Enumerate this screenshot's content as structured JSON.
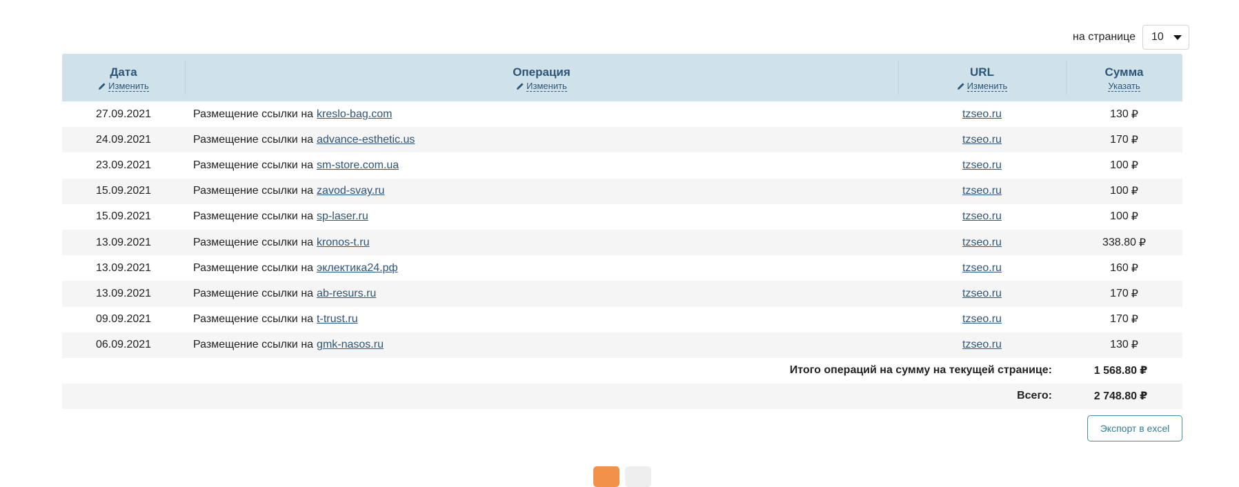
{
  "per_page": {
    "label": "на странице",
    "value": "10"
  },
  "columns": {
    "date": {
      "title": "Дата",
      "action": "Изменить"
    },
    "operation": {
      "title": "Операция",
      "action": "Изменить"
    },
    "url": {
      "title": "URL",
      "action": "Изменить"
    },
    "sum": {
      "title": "Сумма",
      "action": "Указать"
    }
  },
  "operation_prefix": "Размещение ссылки на",
  "currency": "₽",
  "rows": [
    {
      "date": "27.09.2021",
      "domain": "kreslo-bag.com",
      "url": "tzseo.ru",
      "sum": "130"
    },
    {
      "date": "24.09.2021",
      "domain": "advance-esthetic.us",
      "url": "tzseo.ru",
      "sum": "170"
    },
    {
      "date": "23.09.2021",
      "domain": "sm-store.com.ua",
      "url": "tzseo.ru",
      "sum": "100"
    },
    {
      "date": "15.09.2021",
      "domain": "zavod-svay.ru",
      "url": "tzseo.ru",
      "sum": "100"
    },
    {
      "date": "15.09.2021",
      "domain": "sp-laser.ru",
      "url": "tzseo.ru",
      "sum": "100"
    },
    {
      "date": "13.09.2021",
      "domain": "kronos-t.ru",
      "url": "tzseo.ru",
      "sum": "338.80"
    },
    {
      "date": "13.09.2021",
      "domain": "эклектика24.рф",
      "url": "tzseo.ru",
      "sum": "160"
    },
    {
      "date": "13.09.2021",
      "domain": "ab-resurs.ru",
      "url": "tzseo.ru",
      "sum": "170"
    },
    {
      "date": "09.09.2021",
      "domain": "t-trust.ru",
      "url": "tzseo.ru",
      "sum": "170"
    },
    {
      "date": "06.09.2021",
      "domain": "gmk-nasos.ru",
      "url": "tzseo.ru",
      "sum": "130"
    }
  ],
  "totals": {
    "page_label": "Итого операций на сумму на текущей странице:",
    "page_value": "1 568.80",
    "all_label": "Всего:",
    "all_value": "2 748.80"
  },
  "export_label": "Экспорт в excel",
  "colors": {
    "header_bg": "#cfe2ea",
    "link": "#2c5579",
    "pager_active": "#f2924a"
  },
  "icons": {
    "edit": "pencil-icon",
    "dropdown": "caret-down-icon"
  }
}
